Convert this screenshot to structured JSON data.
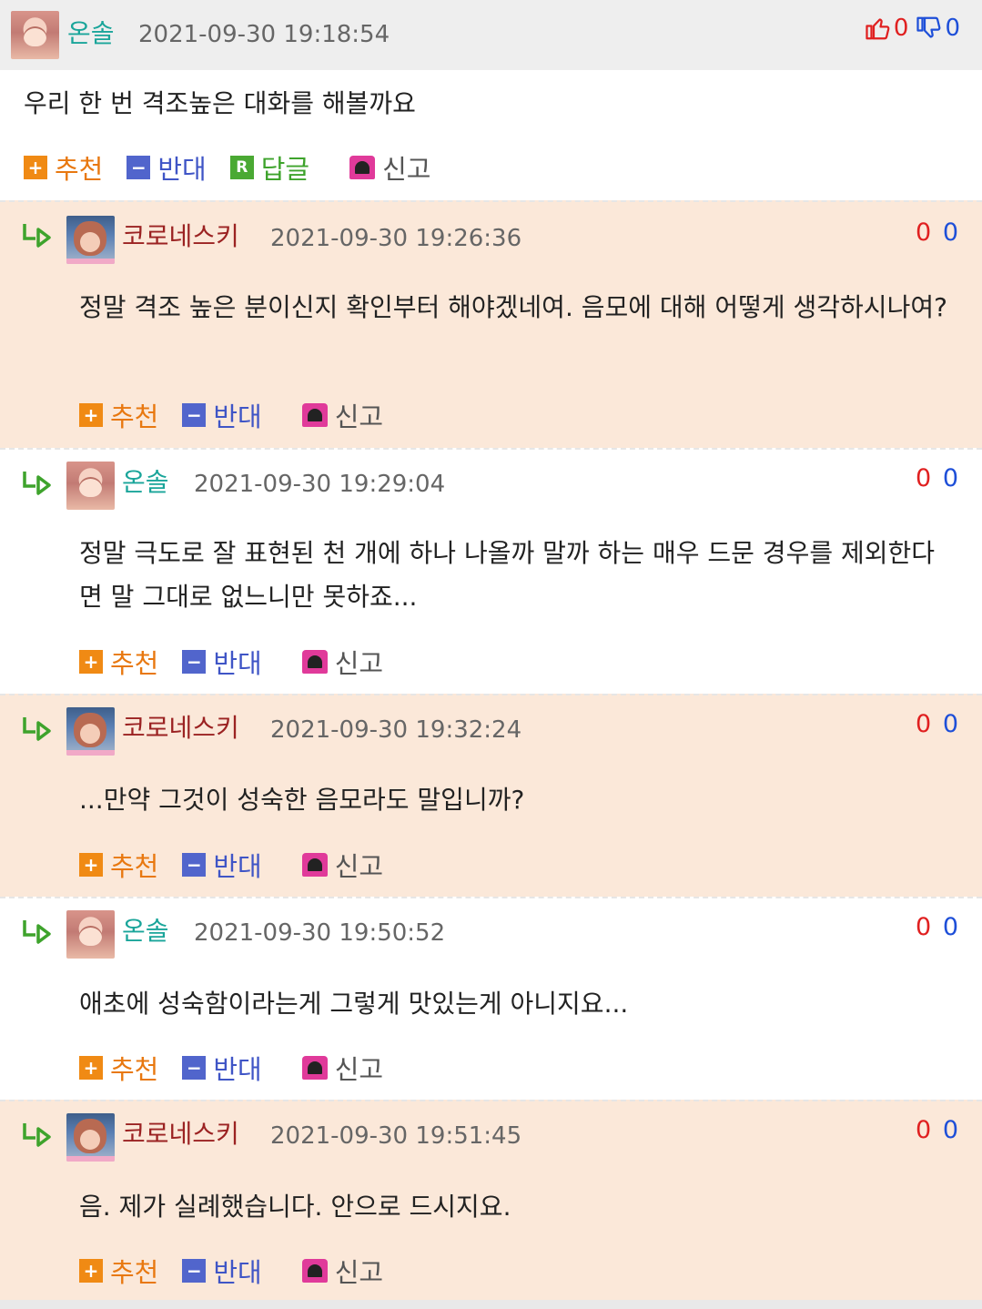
{
  "root": {
    "author": "온솔",
    "datetime": "2021-09-30 19:18:54",
    "likes": "0",
    "dislikes": "0",
    "content": "우리 한 번 격조높은 대화를 해볼까요",
    "actions": {
      "recommend": "추천",
      "oppose": "반대",
      "reply": "답글",
      "report": "신고"
    }
  },
  "replies": [
    {
      "author": "코로네스키",
      "datetime": "2021-09-30 19:26:36",
      "up": "0",
      "down": "0",
      "content": "정말 격조 높은 분이신지 확인부터 해야겠네여. 음모에 대해 어떻게 생각하시나여?",
      "actions": {
        "recommend": "추천",
        "oppose": "반대",
        "report": "신고"
      }
    },
    {
      "author": "온솔",
      "datetime": "2021-09-30 19:29:04",
      "up": "0",
      "down": "0",
      "content": "정말 극도로 잘 표현된 천 개에 하나 나올까 말까 하는 매우 드문 경우를 제외한다면 말 그대로 없느니만 못하죠...",
      "actions": {
        "recommend": "추천",
        "oppose": "반대",
        "report": "신고"
      }
    },
    {
      "author": "코로네스키",
      "datetime": "2021-09-30 19:32:24",
      "up": "0",
      "down": "0",
      "content": "...만약 그것이 성숙한 음모라도 말입니까?",
      "actions": {
        "recommend": "추천",
        "oppose": "반대",
        "report": "신고"
      }
    },
    {
      "author": "온솔",
      "datetime": "2021-09-30 19:50:52",
      "up": "0",
      "down": "0",
      "content": "애초에 성숙함이라는게 그렇게 맛있는게 아니지요...",
      "actions": {
        "recommend": "추천",
        "oppose": "반대",
        "report": "신고"
      }
    },
    {
      "author": "코로네스키",
      "datetime": "2021-09-30 19:51:45",
      "up": "0",
      "down": "0",
      "content": "음. 제가 실례했습니다. 안으로 드시지요.",
      "actions": {
        "recommend": "추천",
        "oppose": "반대",
        "report": "신고"
      }
    }
  ],
  "icons": {
    "plus": "+",
    "minus": "−",
    "reply_badge": "R"
  },
  "colors": {
    "onsol_nick": "#1aa59a",
    "koroneski_nick": "#9b2222",
    "recommend": "#f08a14",
    "oppose": "#5165cc",
    "reply": "#4aa933",
    "report": "#e03a9a",
    "peach_bg": "#fbe8d9"
  }
}
